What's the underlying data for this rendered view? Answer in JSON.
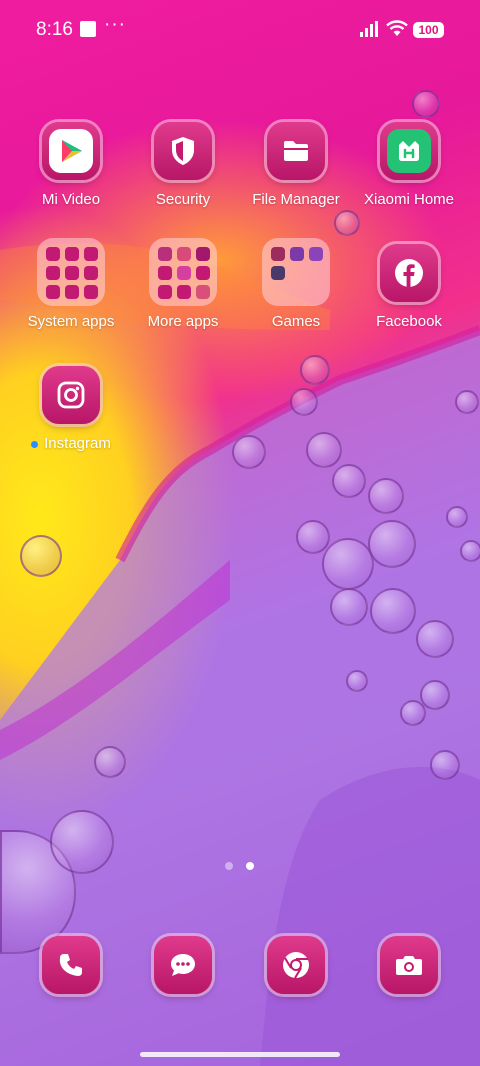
{
  "status_bar": {
    "time": "8:16",
    "more": "···",
    "battery": "100"
  },
  "row1": [
    {
      "label": "Mi Video",
      "icon": "mi-video-icon"
    },
    {
      "label": "Security",
      "icon": "shield-icon"
    },
    {
      "label": "File Manager",
      "icon": "folder-icon"
    },
    {
      "label": "Xiaomi Home",
      "icon": "xiaomi-home-icon"
    }
  ],
  "row2": [
    {
      "label": "System apps",
      "icon": "folder-grid-icon"
    },
    {
      "label": "More apps",
      "icon": "folder-grid-icon"
    },
    {
      "label": "Games",
      "icon": "folder-grid-icon"
    },
    {
      "label": "Facebook",
      "icon": "facebook-icon"
    }
  ],
  "row3": [
    {
      "label": "Instagram",
      "icon": "instagram-icon"
    }
  ],
  "dock": [
    {
      "icon": "phone-icon"
    },
    {
      "icon": "messages-icon"
    },
    {
      "icon": "chrome-icon"
    },
    {
      "icon": "camera-icon"
    }
  ],
  "pager": {
    "pages": 2,
    "current": 2
  },
  "colors": {
    "icon_pink": "#c41a70",
    "accent_blue": "#2b8cff"
  }
}
